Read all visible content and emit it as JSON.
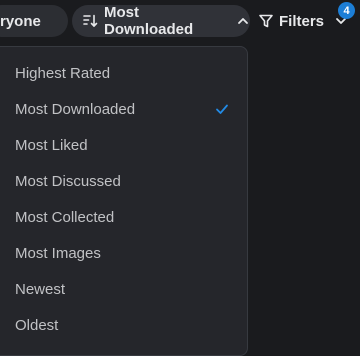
{
  "toolbar": {
    "audience_label": "ryone",
    "sort_label": "Most Downloaded",
    "filters_label": "Filters",
    "filters_count": "4"
  },
  "sort_menu": {
    "options": [
      {
        "label": "Highest Rated",
        "selected": false
      },
      {
        "label": "Most Downloaded",
        "selected": true
      },
      {
        "label": "Most Liked",
        "selected": false
      },
      {
        "label": "Most Discussed",
        "selected": false
      },
      {
        "label": "Most Collected",
        "selected": false
      },
      {
        "label": "Most Images",
        "selected": false
      },
      {
        "label": "Newest",
        "selected": false
      },
      {
        "label": "Oldest",
        "selected": false
      }
    ]
  },
  "colors": {
    "background": "#1a1b1e",
    "pill": "#2c2e33",
    "menu": "#25262b",
    "accent": "#228be6",
    "badge": "#1c7ed6"
  },
  "icons": {
    "sort": "sort-descending-icon",
    "chevron_up": "chevron-up-icon",
    "chevron_down": "chevron-down-icon",
    "filter": "filter-icon",
    "check": "check-icon"
  }
}
